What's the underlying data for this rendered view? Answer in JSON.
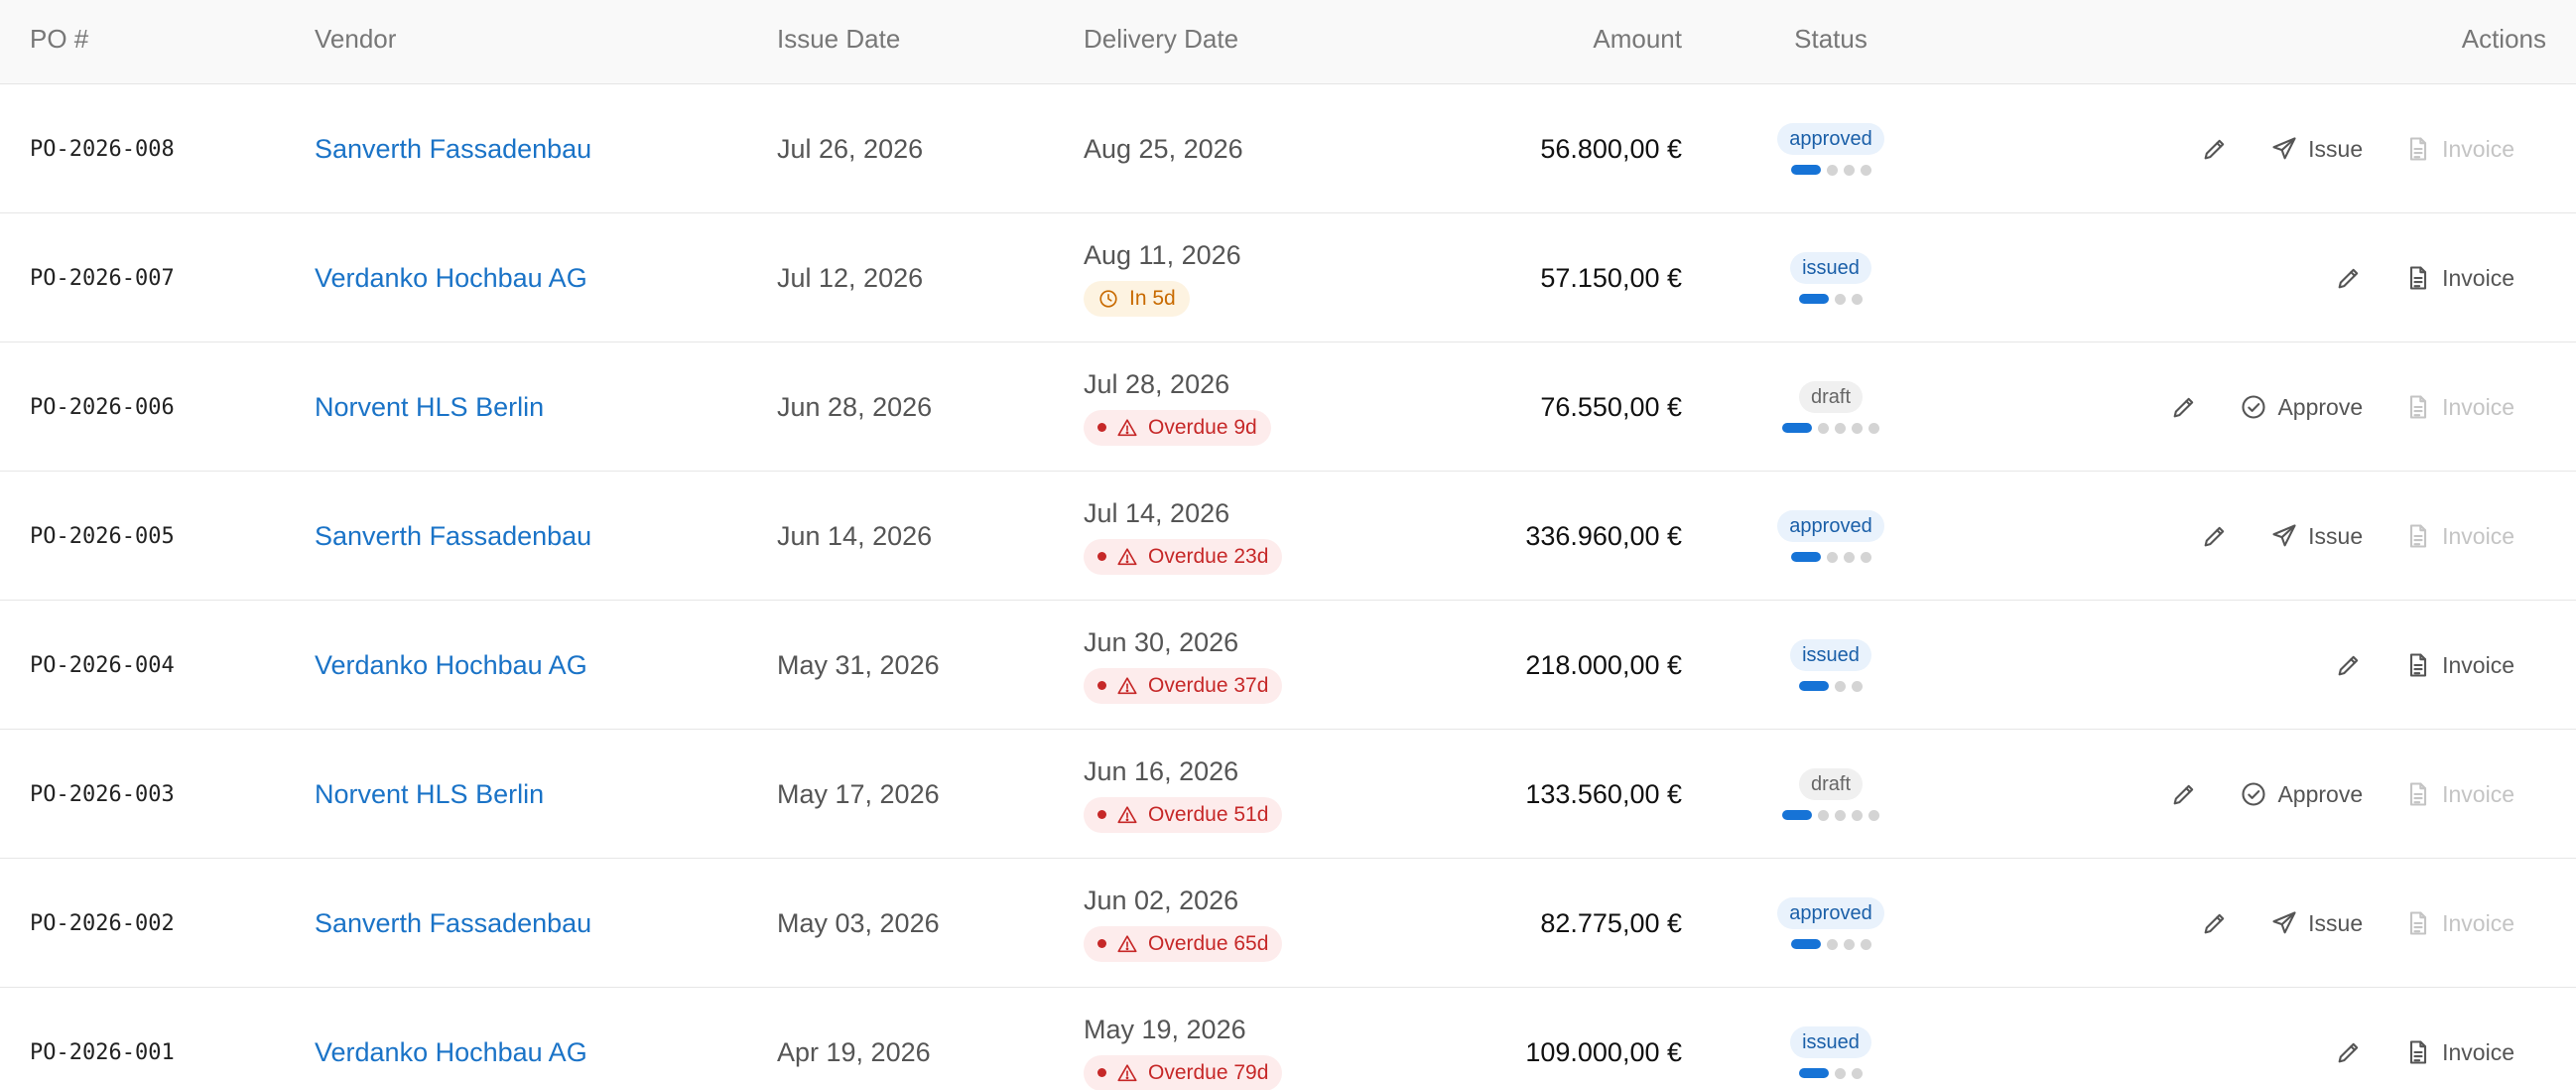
{
  "columns": {
    "po": "PO #",
    "vendor": "Vendor",
    "issue_date": "Issue Date",
    "delivery_date": "Delivery Date",
    "amount": "Amount",
    "status": "Status",
    "actions": "Actions"
  },
  "colors": {
    "accent": "#1673d6",
    "link": "#1a73c7",
    "overdue": "#c62828",
    "warning": "#c86a00"
  },
  "rows": [
    {
      "po": "PO-2026-008",
      "vendor": "Sanverth Fassadenbau",
      "issue_date": "Jul 26, 2026",
      "delivery_date": "Aug 25, 2026",
      "due_note": "",
      "due_kind": "none",
      "amount": "56.800,00 €",
      "status": "approved",
      "steps_done": 1,
      "steps_total": 4,
      "primary_action": "Issue",
      "primary_icon": "send-icon",
      "invoice": "Invoice",
      "invoice_enabled": false
    },
    {
      "po": "PO-2026-007",
      "vendor": "Verdanko Hochbau AG",
      "issue_date": "Jul 12, 2026",
      "delivery_date": "Aug 11, 2026",
      "due_note": "In 5d",
      "due_kind": "warning",
      "amount": "57.150,00 €",
      "status": "issued",
      "steps_done": 1,
      "steps_total": 3,
      "primary_action": "",
      "primary_icon": "",
      "invoice": "Invoice",
      "invoice_enabled": true
    },
    {
      "po": "PO-2026-006",
      "vendor": "Norvent HLS Berlin",
      "issue_date": "Jun 28, 2026",
      "delivery_date": "Jul 28, 2026",
      "due_note": "Overdue 9d",
      "due_kind": "overdue",
      "amount": "76.550,00 €",
      "status": "draft",
      "steps_done": 1,
      "steps_total": 5,
      "primary_action": "Approve",
      "primary_icon": "check-circle-icon",
      "invoice": "Invoice",
      "invoice_enabled": false
    },
    {
      "po": "PO-2026-005",
      "vendor": "Sanverth Fassadenbau",
      "issue_date": "Jun 14, 2026",
      "delivery_date": "Jul 14, 2026",
      "due_note": "Overdue 23d",
      "due_kind": "overdue",
      "amount": "336.960,00 €",
      "status": "approved",
      "steps_done": 1,
      "steps_total": 4,
      "primary_action": "Issue",
      "primary_icon": "send-icon",
      "invoice": "Invoice",
      "invoice_enabled": false
    },
    {
      "po": "PO-2026-004",
      "vendor": "Verdanko Hochbau AG",
      "issue_date": "May 31, 2026",
      "delivery_date": "Jun 30, 2026",
      "due_note": "Overdue 37d",
      "due_kind": "overdue",
      "amount": "218.000,00 €",
      "status": "issued",
      "steps_done": 1,
      "steps_total": 3,
      "primary_action": "",
      "primary_icon": "",
      "invoice": "Invoice",
      "invoice_enabled": true
    },
    {
      "po": "PO-2026-003",
      "vendor": "Norvent HLS Berlin",
      "issue_date": "May 17, 2026",
      "delivery_date": "Jun 16, 2026",
      "due_note": "Overdue 51d",
      "due_kind": "overdue",
      "amount": "133.560,00 €",
      "status": "draft",
      "steps_done": 1,
      "steps_total": 5,
      "primary_action": "Approve",
      "primary_icon": "check-circle-icon",
      "invoice": "Invoice",
      "invoice_enabled": false
    },
    {
      "po": "PO-2026-002",
      "vendor": "Sanverth Fassadenbau",
      "issue_date": "May 03, 2026",
      "delivery_date": "Jun 02, 2026",
      "due_note": "Overdue 65d",
      "due_kind": "overdue",
      "amount": "82.775,00 €",
      "status": "approved",
      "steps_done": 1,
      "steps_total": 4,
      "primary_action": "Issue",
      "primary_icon": "send-icon",
      "invoice": "Invoice",
      "invoice_enabled": false
    },
    {
      "po": "PO-2026-001",
      "vendor": "Verdanko Hochbau AG",
      "issue_date": "Apr 19, 2026",
      "delivery_date": "May 19, 2026",
      "due_note": "Overdue 79d",
      "due_kind": "overdue",
      "amount": "109.000,00 €",
      "status": "issued",
      "steps_done": 1,
      "steps_total": 3,
      "primary_action": "",
      "primary_icon": "",
      "invoice": "Invoice",
      "invoice_enabled": true
    }
  ]
}
